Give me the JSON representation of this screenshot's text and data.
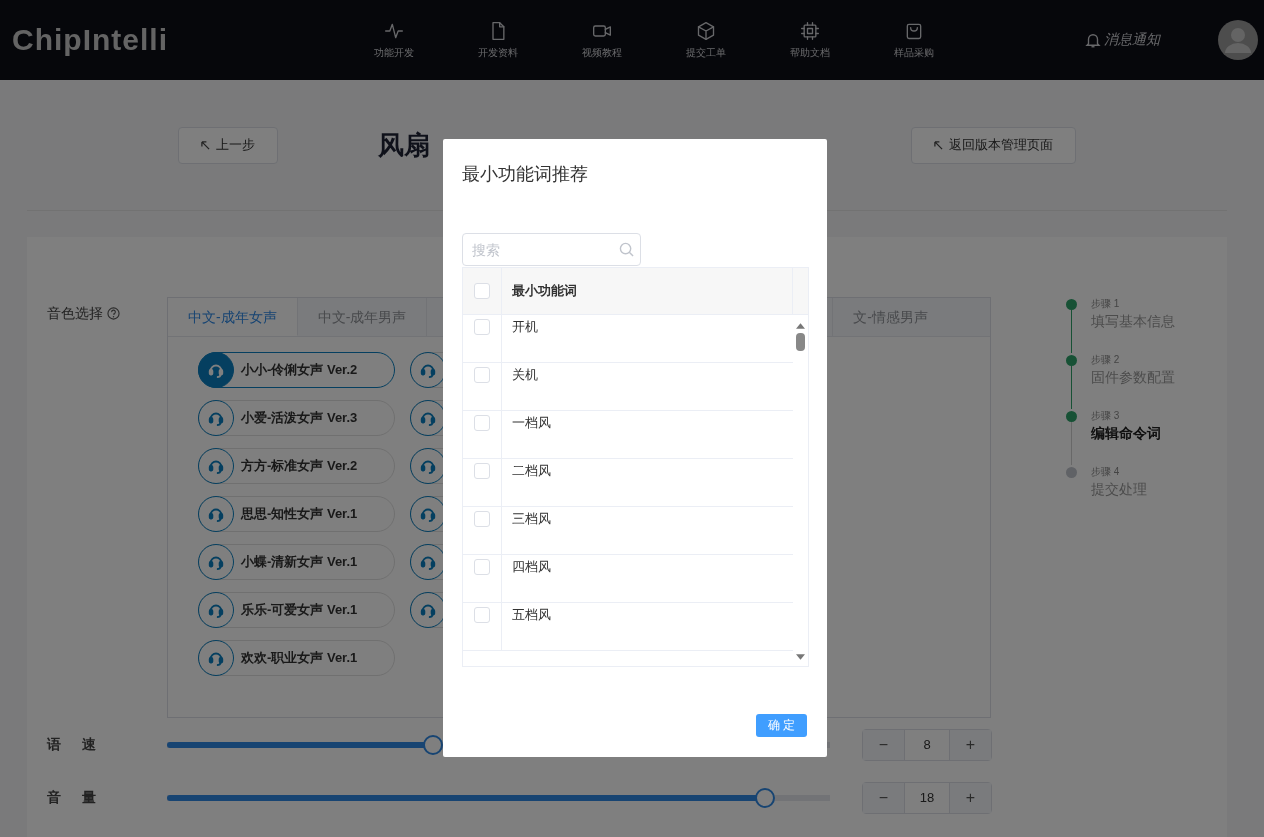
{
  "header": {
    "logo": "ChipIntelli",
    "nav": [
      {
        "label": "功能开发"
      },
      {
        "label": "开发资料"
      },
      {
        "label": "视频教程"
      },
      {
        "label": "提交工单"
      },
      {
        "label": "帮助文档"
      },
      {
        "label": "样品采购"
      }
    ],
    "notifications": "消息通知"
  },
  "page": {
    "back_button": "上一步",
    "title": "风扇",
    "return_button": "返回版本管理页面"
  },
  "voice": {
    "label": "音色选择",
    "tabs": [
      {
        "label": "中文-成年女声",
        "selected": true
      },
      {
        "label": "中文-成年男声",
        "selected": false
      },
      {
        "label": "文-情感男声",
        "selected": false
      }
    ],
    "voices": [
      {
        "name": "小小-伶俐女声 Ver.2",
        "selected": true
      },
      {
        "name": "小爱-活泼女声 Ver.3",
        "selected": false
      },
      {
        "name": "方方-标准女声 Ver.2",
        "selected": false
      },
      {
        "name": "思思-知性女声 Ver.1",
        "selected": false
      },
      {
        "name": "小蝶-清新女声 Ver.1",
        "selected": false
      },
      {
        "name": "乐乐-可爱女声 Ver.1",
        "selected": false
      },
      {
        "name": "欢欢-职业女声 Ver.1",
        "selected": false
      }
    ],
    "voices_column_2": [
      {
        "selected": false
      },
      {
        "selected": false
      },
      {
        "selected": false
      },
      {
        "selected": false
      },
      {
        "selected": false
      },
      {
        "selected": false
      }
    ]
  },
  "steps": [
    {
      "step": "步骤 1",
      "title": "填写基本信息",
      "done": true,
      "current": false
    },
    {
      "step": "步骤 2",
      "title": "固件参数配置",
      "done": true,
      "current": false
    },
    {
      "step": "步骤 3",
      "title": "编辑命令词",
      "done": true,
      "current": true
    },
    {
      "step": "步骤 4",
      "title": "提交处理",
      "done": false,
      "current": false
    }
  ],
  "sliders": [
    {
      "label": "语 速",
      "level": 0.4,
      "value": "8",
      "minus": "−",
      "plus": "+"
    },
    {
      "label": "音 量",
      "level": 0.9,
      "value": "18",
      "minus": "−",
      "plus": "+"
    }
  ],
  "dialog": {
    "title": "最小功能词推荐",
    "search_placeholder": "搜索",
    "column": "最小功能词",
    "select_all_checked": false,
    "rows": [
      {
        "word": "开机",
        "checked": false
      },
      {
        "word": "关机",
        "checked": false
      },
      {
        "word": "一档风",
        "checked": false
      },
      {
        "word": "二档风",
        "checked": false
      },
      {
        "word": "三档风",
        "checked": false
      },
      {
        "word": "四档风",
        "checked": false
      },
      {
        "word": "五档风",
        "checked": false
      }
    ],
    "confirm": "确 定"
  }
}
